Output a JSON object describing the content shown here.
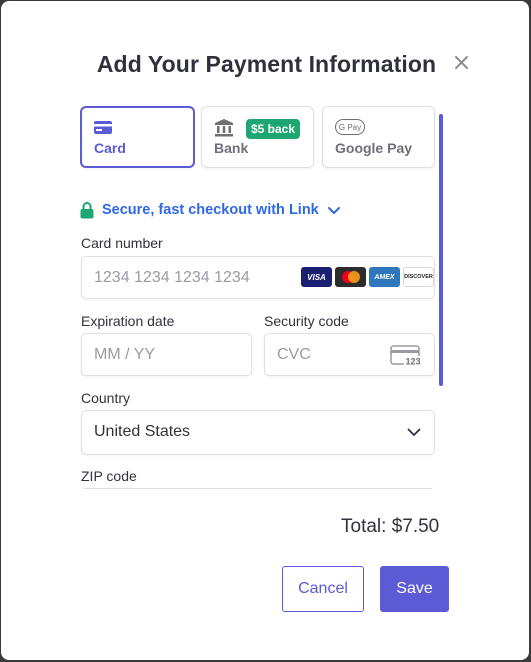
{
  "dialog": {
    "title": "Add Your Payment Information"
  },
  "tabs": [
    {
      "label": "Card",
      "icon": "credit-card-icon",
      "active": true
    },
    {
      "label": "Bank",
      "icon": "bank-icon",
      "badge": "$5 back"
    },
    {
      "label": "Google Pay",
      "icon": "google-pay-icon",
      "icon_text": "G Pay"
    }
  ],
  "link": {
    "text": "Secure, fast checkout with Link"
  },
  "card_number": {
    "label": "Card number",
    "placeholder": "1234 1234 1234 1234",
    "brands": [
      "VISA",
      "Mastercard",
      "AMEX",
      "DISCOVER"
    ]
  },
  "expiration": {
    "label": "Expiration date",
    "placeholder": "MM / YY"
  },
  "security": {
    "label": "Security code",
    "placeholder": "CVC",
    "icon_text": "123"
  },
  "country": {
    "label": "Country",
    "value": "United States"
  },
  "zip": {
    "label": "ZIP code"
  },
  "summary": {
    "total": "Total: $7.50"
  },
  "actions": {
    "cancel_label": "Cancel",
    "save_label": "Save"
  },
  "colors": {
    "accent": "#5b5bd6",
    "link": "#2d68e6",
    "badge": "#1ea672",
    "text": "#30313d"
  }
}
